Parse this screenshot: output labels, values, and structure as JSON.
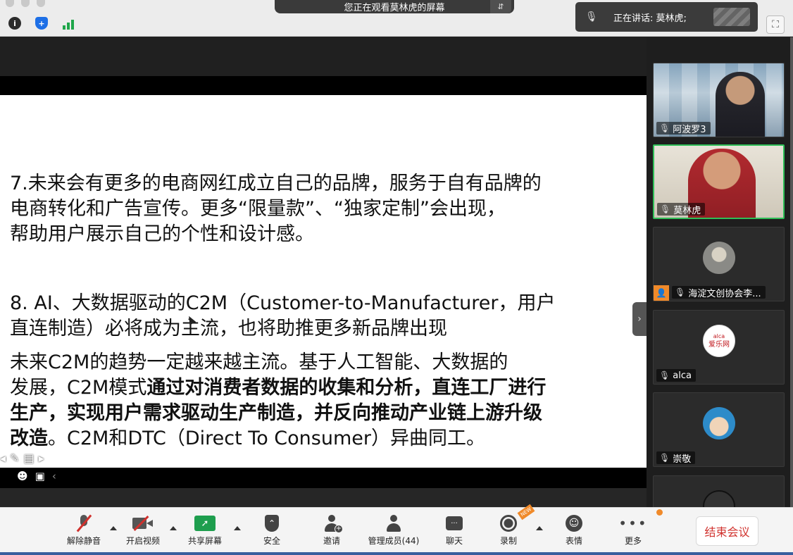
{
  "banner": {
    "viewing_text": "您正在观看莫林虎的屏幕",
    "menu_glyph": "⇵"
  },
  "speaking": {
    "label": "正在讲话: 莫林虎;"
  },
  "slide": {
    "para7": "7.未来会有更多的电商网红成立自己的品牌，服务于自有品牌的\n电商转化和广告宣传。更多“限量款”、“独家定制”会出现，\n帮助用户展示自己的个性和设计感。",
    "para8_title": "8. AI、大数据驱动的C2M（Customer-to-Manufacturer，用户\n直连制造）必将成为主流，也将助推更多新品牌出现",
    "para8_body_lead": "    未来C2M的趋势一定越来越主流。基于人工智能、大数据的\n发展，C2M模式",
    "para8_body_bold": "通过对消费者数据的收集和分析，直连工厂进行\n生产，实现用户需求驱动生产制造，并反向推动产业链上游升级\n改造",
    "para8_body_tail": "。C2M和DTC（Direct To Consumer）异曲同工。"
  },
  "participants": [
    {
      "name": "阿波罗3"
    },
    {
      "name": "莫林虎"
    },
    {
      "name": "海淀文创协会李..."
    },
    {
      "name": "alca",
      "avatar_text_1": "爱乐网",
      "avatar_text_2": "alca"
    },
    {
      "name": "崇敬"
    },
    {
      "name": ""
    }
  ],
  "toolbar": {
    "unmute": "解除静音",
    "start_video": "开启视频",
    "share_screen": "共享屏幕",
    "security": "安全",
    "invite": "邀请",
    "participants": "管理成员(44)",
    "chat": "聊天",
    "record": "录制",
    "reactions": "表情",
    "more": "更多",
    "end_meeting": "结束会议",
    "new_badge": "NEW"
  },
  "colors": {
    "speaking_border": "#2fbf57",
    "end_text": "#d0312d",
    "share_green": "#1e9e4e",
    "accent_orange": "#f08a2a"
  },
  "icons": [
    "info-icon",
    "shield-icon",
    "signal-icon",
    "mic-muted-icon",
    "fullscreen-icon",
    "video-off-icon",
    "share-screen-icon",
    "security-icon",
    "invite-icon",
    "participants-icon",
    "chat-icon",
    "record-icon",
    "emoji-icon",
    "more-icon"
  ]
}
